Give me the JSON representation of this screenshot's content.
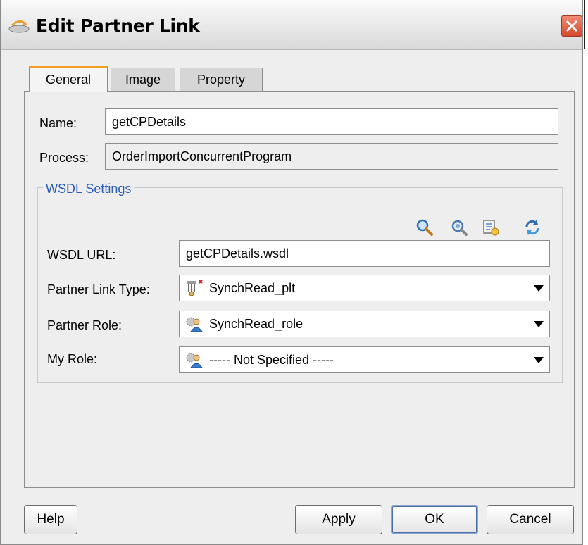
{
  "window": {
    "title": "Edit Partner Link"
  },
  "tabs": [
    {
      "label": "General",
      "active": true
    },
    {
      "label": "Image",
      "active": false
    },
    {
      "label": "Property",
      "active": false
    }
  ],
  "general": {
    "name_label": "Name:",
    "name_value": "getCPDetails",
    "process_label": "Process:",
    "process_value": "OrderImportConcurrentProgram"
  },
  "wsdl": {
    "group_title": "WSDL Settings",
    "toolbar_icons": [
      "search-icon",
      "browse-wsdl-icon",
      "service-explorer-icon",
      "refresh-icon"
    ],
    "url_label": "WSDL URL:",
    "url_value": "getCPDetails.wsdl",
    "plt_label": "Partner Link Type:",
    "plt_value": "SynchRead_plt",
    "partner_role_label": "Partner Role:",
    "partner_role_value": "SynchRead_role",
    "my_role_label": "My Role:",
    "my_role_value": "----- Not Specified -----"
  },
  "buttons": {
    "help": "Help",
    "apply": "Apply",
    "ok": "OK",
    "cancel": "Cancel"
  },
  "colors": {
    "active_tab_accent": "#f0a020",
    "group_title": "#2a5bb5",
    "close_button": "#d44a2d"
  }
}
